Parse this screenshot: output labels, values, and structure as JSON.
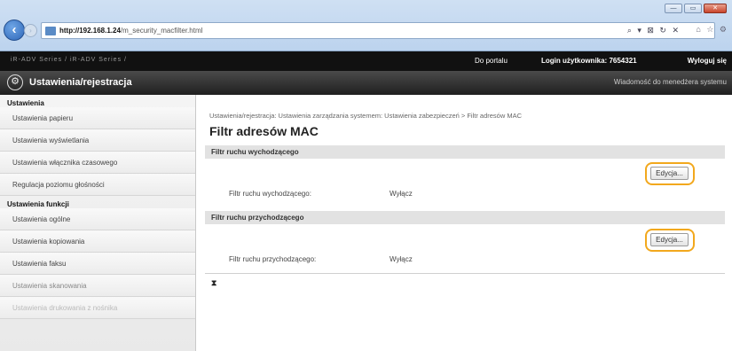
{
  "browser": {
    "url_host": "http://192.168.1.24",
    "url_path": "/m_security_macfilter.html",
    "address_tools": "⌕ ▾ ⊠ ↻ ✕",
    "right_icons": "⌂ ☆ ⚙",
    "window_buttons": [
      "—",
      "▭",
      "✕"
    ]
  },
  "topbar": {
    "model": "iR-ADV Series / iR-ADV Series /",
    "portal_link": "Do portalu",
    "login_text": "Login użytkownika: 7654321",
    "logout_link": "Wyloguj się"
  },
  "titlebar": {
    "title": "Ustawienia/rejestracja",
    "admin_message": "Wiadomość do menedżera systemu"
  },
  "sidebar": {
    "group1": "Ustawienia",
    "items1": [
      "Ustawienia papieru",
      "Ustawienia wyświetlania",
      "Ustawienia włącznika czasowego",
      "Regulacja poziomu głośności"
    ],
    "group2": "Ustawienia funkcji",
    "items2": [
      "Ustawienia ogólne",
      "Ustawienia kopiowania",
      "Ustawienia faksu",
      "Ustawienia skanowania",
      "Ustawienia drukowania z nośnika"
    ]
  },
  "main": {
    "breadcrumb": "Ustawienia/rejestracja: Ustawienia zarządzania systemem: Ustawienia zabezpieczeń > Filtr adresów MAC",
    "title": "Filtr adresów MAC",
    "outbound": {
      "header": "Filtr ruchu wychodzącego",
      "edit_label": "Edycja...",
      "row_label": "Filtr ruchu wychodzącego:",
      "row_value": "Wyłącz"
    },
    "inbound": {
      "header": "Filtr ruchu przychodzącego",
      "edit_label": "Edycja...",
      "row_label": "Filtr ruchu przychodzącego:",
      "row_value": "Wyłącz"
    },
    "top_icon": "⧗"
  },
  "colors": {
    "highlight": "#f2a81d",
    "topbar": "#111111",
    "section": "#e2e2e2"
  }
}
